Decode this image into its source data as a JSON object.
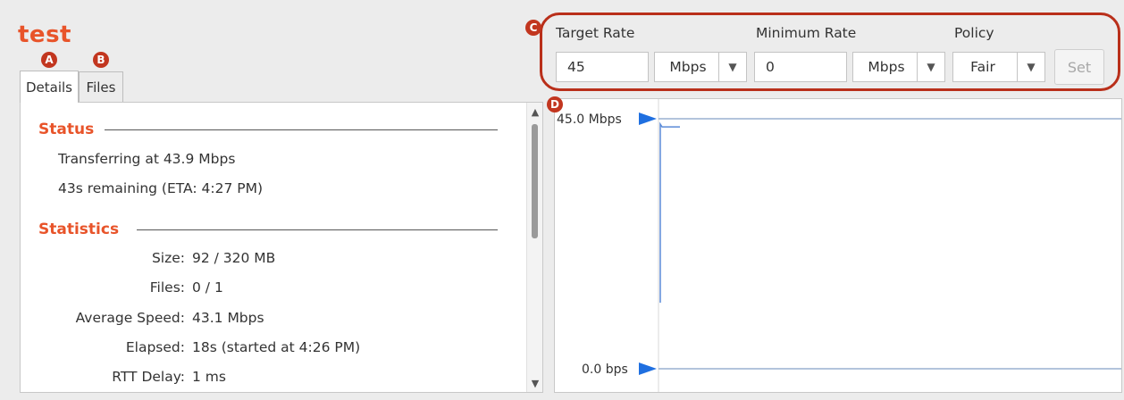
{
  "transfer": {
    "name": "test"
  },
  "badges": {
    "a": "A",
    "b": "B",
    "c": "C",
    "d": "D"
  },
  "tabs": [
    {
      "label": "Details",
      "active": true
    },
    {
      "label": "Files",
      "active": false
    }
  ],
  "status": {
    "heading": "Status",
    "lines": [
      "Transferring at 43.9 Mbps",
      "43s remaining (ETA: 4:27 PM)"
    ]
  },
  "statistics": {
    "heading": "Statistics",
    "rows": [
      {
        "label": "Size:",
        "value": "92 / 320 MB"
      },
      {
        "label": "Files:",
        "value": "0 / 1"
      },
      {
        "label": "Average Speed:",
        "value": "43.1 Mbps"
      },
      {
        "label": "Elapsed:",
        "value": "18s (started at 4:26 PM)"
      },
      {
        "label": "RTT Delay:",
        "value": "1 ms"
      }
    ]
  },
  "rate_controls": {
    "target_rate": {
      "label": "Target Rate",
      "value": "45",
      "unit": "Mbps"
    },
    "minimum_rate": {
      "label": "Minimum Rate",
      "value": "0",
      "unit": "Mbps"
    },
    "policy": {
      "label": "Policy",
      "value": "Fair"
    },
    "set_label": "Set"
  },
  "chart_data": {
    "type": "line",
    "y_top_label": "45.0 Mbps",
    "y_bottom_label": "0.0 bps",
    "ylim": [
      0,
      45
    ],
    "target_rate_marker": 45,
    "min_rate_marker": 0,
    "series": [
      {
        "values": [
          0,
          45,
          44.5,
          44.5,
          44.5
        ]
      }
    ],
    "colors": {
      "marker": "#1f6fe0",
      "line": "#5b8bd8",
      "guide": "#9ab0d0"
    }
  },
  "icons": {
    "scroll_up": "▲",
    "scroll_down": "▼",
    "chevron": "▼"
  }
}
